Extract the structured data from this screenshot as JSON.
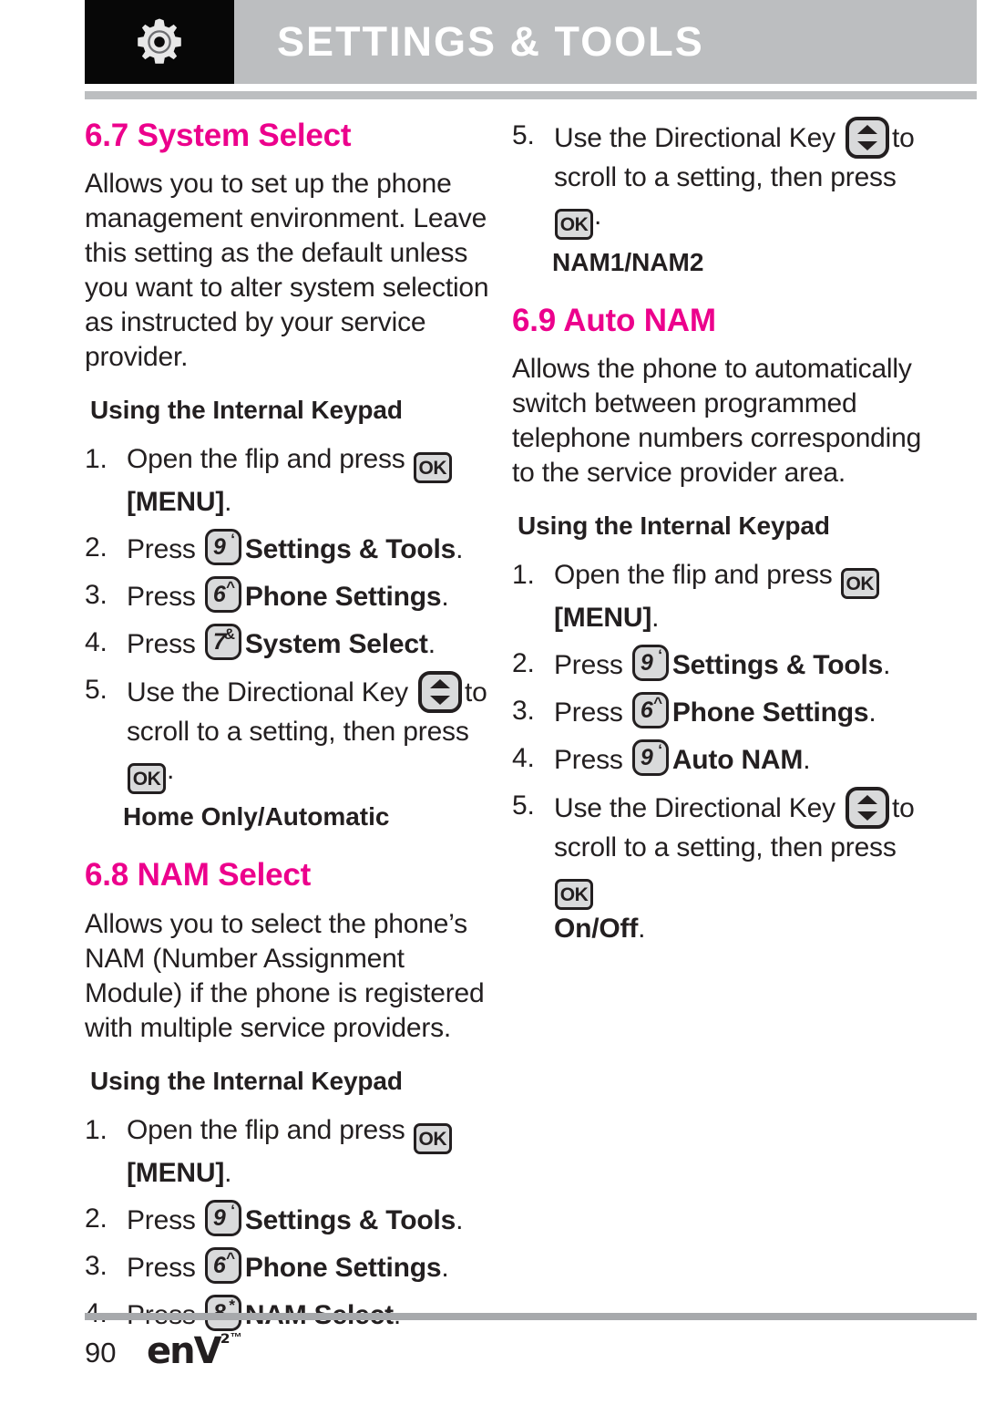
{
  "header": {
    "title": "SETTINGS & TOOLS",
    "icon": "gear-icon"
  },
  "keys": {
    "ok_label": "OK",
    "dir_key_name": "directional-key-icon",
    "k9": {
      "digit": "9",
      "sup": "‘"
    },
    "k6": {
      "digit": "6",
      "sup": "^"
    },
    "k7": {
      "digit": "7",
      "sup": "&"
    },
    "k8": {
      "digit": "8",
      "sup": "*"
    }
  },
  "left_column": {
    "section_67": {
      "heading": "6.7 System Select",
      "body": "Allows you to set up the phone management environment. Leave this setting as the default unless you want to alter system selection as instructed by your service provider.",
      "sub_heading": "Using the Internal Keypad",
      "steps": [
        {
          "num": "1.",
          "pre": "Open the flip and press",
          "key": "ok",
          "post": "",
          "bold_after": "[MENU]",
          "trailing": "."
        },
        {
          "num": "2.",
          "pre": "Press",
          "key": "k9",
          "bold_after": "Settings & Tools",
          "trailing": "."
        },
        {
          "num": "3.",
          "pre": "Press",
          "key": "k6",
          "bold_after": "Phone Settings",
          "trailing": "."
        },
        {
          "num": "4.",
          "pre": "Press",
          "key": "k7",
          "bold_after": "System Select",
          "trailing": "."
        },
        {
          "num": "5.",
          "pre": "Use the Directional Key",
          "key": "dir",
          "mid": "to scroll to a setting, then press",
          "key2": "ok",
          "trailing": "."
        }
      ],
      "value_label": "Home Only/Automatic"
    },
    "section_68": {
      "heading": "6.8 NAM Select",
      "body": "Allows you to select the phone’s NAM (Number Assignment Module) if the phone is registered with multiple service providers.",
      "sub_heading": "Using the Internal Keypad",
      "steps": [
        {
          "num": "1.",
          "pre": "Open the flip and press",
          "key": "ok",
          "bold_after": "[MENU]",
          "trailing": "."
        },
        {
          "num": "2.",
          "pre": "Press",
          "key": "k9",
          "bold_after": "Settings & Tools",
          "trailing": "."
        },
        {
          "num": "3.",
          "pre": "Press",
          "key": "k6",
          "bold_after": "Phone Settings",
          "trailing": "."
        },
        {
          "num": "4.",
          "pre": "Press",
          "key": "k8",
          "bold_after": "NAM Select",
          "trailing": "."
        }
      ]
    }
  },
  "right_column": {
    "continued_step": {
      "num": "5.",
      "pre": "Use the Directional Key",
      "mid": "to scroll to a setting, then press",
      "trailing": "."
    },
    "continued_value_label": "NAM1/NAM2",
    "section_69": {
      "heading": "6.9 Auto NAM",
      "body": "Allows the phone to automatically switch between programmed telephone numbers corresponding to the service provider area.",
      "sub_heading": "Using the Internal Keypad",
      "steps": [
        {
          "num": "1.",
          "pre": "Open the flip and press",
          "key": "ok",
          "bold_after": "[MENU]",
          "trailing": "."
        },
        {
          "num": "2.",
          "pre": "Press",
          "key": "k9",
          "bold_after": "Settings & Tools",
          "trailing": "."
        },
        {
          "num": "3.",
          "pre": "Press",
          "key": "k6",
          "bold_after": "Phone Settings",
          "trailing": "."
        },
        {
          "num": "4.",
          "pre": "Press",
          "key": "k9",
          "bold_after": "Auto NAM",
          "trailing": "."
        },
        {
          "num": "5.",
          "pre": "Use the Directional Key",
          "mid": "to scroll to a setting, then press",
          "trailing": ""
        }
      ],
      "value_label": "On/Off"
    }
  },
  "footer": {
    "page_number": "90",
    "logo_text": "enV",
    "logo_sup": "²",
    "logo_tm": "™"
  },
  "colors": {
    "accent_pink": "#ec008c",
    "header_gray": "#bcbec0",
    "rule_gray": "#a7a9ac",
    "key_fill": "#d9dadb",
    "text": "#231f20"
  }
}
